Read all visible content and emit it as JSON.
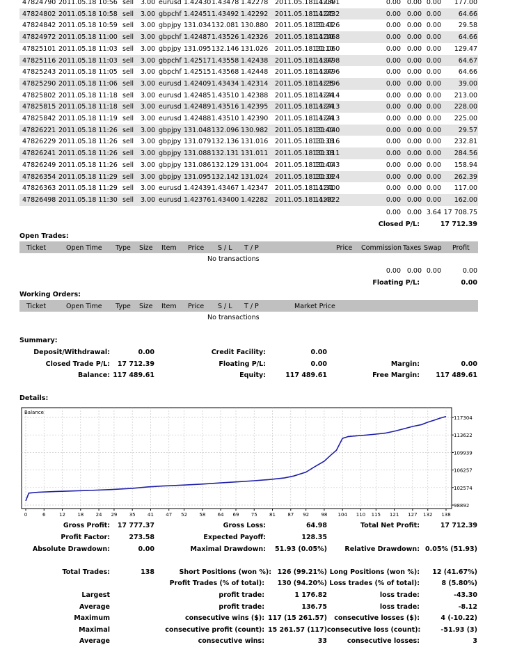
{
  "closed_trades": [
    {
      "ticket": "47824790",
      "open_time": "2011.05.18 10:56",
      "type": "sell",
      "size": "3.00",
      "item": "eurusd",
      "price": "1.42430",
      "sl": "1.43478",
      "tp": "1.42278",
      "close_time": "2011.05.18 11:04",
      "close_price": "1.42391",
      "commission": "0.00",
      "taxes": "0.00",
      "swap": "0.00",
      "profit": "177.00"
    },
    {
      "ticket": "47824802",
      "open_time": "2011.05.18 10:58",
      "type": "sell",
      "size": "3.00",
      "item": "gbpchf",
      "price": "1.42451",
      "sl": "1.43492",
      "tp": "1.42292",
      "close_time": "2011.05.18 11:25",
      "close_price": "1.42432",
      "commission": "0.00",
      "taxes": "0.00",
      "swap": "0.00",
      "profit": "64.66"
    },
    {
      "ticket": "47824842",
      "open_time": "2011.05.18 10:59",
      "type": "sell",
      "size": "3.00",
      "item": "gbpjpy",
      "price": "131.034",
      "sl": "132.081",
      "tp": "130.880",
      "close_time": "2011.05.18 11:41",
      "close_price": "131.026",
      "commission": "0.00",
      "taxes": "0.00",
      "swap": "0.00",
      "profit": "29.58"
    },
    {
      "ticket": "47824972",
      "open_time": "2011.05.18 11:00",
      "type": "sell",
      "size": "3.00",
      "item": "gbpchf",
      "price": "1.42487",
      "sl": "1.43526",
      "tp": "1.42326",
      "close_time": "2011.05.18 11:10",
      "close_price": "1.42468",
      "commission": "0.00",
      "taxes": "0.00",
      "swap": "0.00",
      "profit": "64.66"
    },
    {
      "ticket": "47825101",
      "open_time": "2011.05.18 11:03",
      "type": "sell",
      "size": "3.00",
      "item": "gbpjpy",
      "price": "131.095",
      "sl": "132.146",
      "tp": "131.026",
      "close_time": "2011.05.18 11:10",
      "close_price": "131.060",
      "commission": "0.00",
      "taxes": "0.00",
      "swap": "0.00",
      "profit": "129.47"
    },
    {
      "ticket": "47825116",
      "open_time": "2011.05.18 11:03",
      "type": "sell",
      "size": "3.00",
      "item": "gbpchf",
      "price": "1.42517",
      "sl": "1.43558",
      "tp": "1.42438",
      "close_time": "2011.05.18 11:07",
      "close_price": "1.42498",
      "commission": "0.00",
      "taxes": "0.00",
      "swap": "0.00",
      "profit": "64.67"
    },
    {
      "ticket": "47825243",
      "open_time": "2011.05.18 11:05",
      "type": "sell",
      "size": "3.00",
      "item": "gbpchf",
      "price": "1.42515",
      "sl": "1.43568",
      "tp": "1.42448",
      "close_time": "2011.05.18 11:07",
      "close_price": "1.42496",
      "commission": "0.00",
      "taxes": "0.00",
      "swap": "0.00",
      "profit": "64.66"
    },
    {
      "ticket": "47825290",
      "open_time": "2011.05.18 11:06",
      "type": "sell",
      "size": "3.00",
      "item": "eurusd",
      "price": "1.42409",
      "sl": "1.43434",
      "tp": "1.42314",
      "close_time": "2011.05.18 11:25",
      "close_price": "1.42396",
      "commission": "0.00",
      "taxes": "0.00",
      "swap": "0.00",
      "profit": "39.00"
    },
    {
      "ticket": "47825802",
      "open_time": "2011.05.18 11:18",
      "type": "sell",
      "size": "3.00",
      "item": "eurusd",
      "price": "1.42485",
      "sl": "1.43510",
      "tp": "1.42388",
      "close_time": "2011.05.18 11:24",
      "close_price": "1.42414",
      "commission": "0.00",
      "taxes": "0.00",
      "swap": "0.00",
      "profit": "213.00"
    },
    {
      "ticket": "47825815",
      "open_time": "2011.05.18 11:18",
      "type": "sell",
      "size": "3.00",
      "item": "eurusd",
      "price": "1.42489",
      "sl": "1.43516",
      "tp": "1.42395",
      "close_time": "2011.05.18 11:24",
      "close_price": "1.42413",
      "commission": "0.00",
      "taxes": "0.00",
      "swap": "0.00",
      "profit": "228.00"
    },
    {
      "ticket": "47825842",
      "open_time": "2011.05.18 11:19",
      "type": "sell",
      "size": "3.00",
      "item": "eurusd",
      "price": "1.42488",
      "sl": "1.43510",
      "tp": "1.42390",
      "close_time": "2011.05.18 11:24",
      "close_price": "1.42413",
      "commission": "0.00",
      "taxes": "0.00",
      "swap": "0.00",
      "profit": "225.00"
    },
    {
      "ticket": "47826221",
      "open_time": "2011.05.18 11:26",
      "type": "sell",
      "size": "3.00",
      "item": "gbpjpy",
      "price": "131.048",
      "sl": "132.096",
      "tp": "130.982",
      "close_time": "2011.05.18 11:40",
      "close_price": "131.040",
      "commission": "0.00",
      "taxes": "0.00",
      "swap": "0.00",
      "profit": "29.57"
    },
    {
      "ticket": "47826229",
      "open_time": "2011.05.18 11:26",
      "type": "sell",
      "size": "3.00",
      "item": "gbpjpy",
      "price": "131.079",
      "sl": "132.136",
      "tp": "131.016",
      "close_time": "2011.05.18 11:38",
      "close_price": "131.016",
      "commission": "0.00",
      "taxes": "0.00",
      "swap": "0.00",
      "profit": "232.81"
    },
    {
      "ticket": "47826241",
      "open_time": "2011.05.18 11:26",
      "type": "sell",
      "size": "3.00",
      "item": "gbpjpy",
      "price": "131.088",
      "sl": "132.131",
      "tp": "131.011",
      "close_time": "2011.05.18 11:38",
      "close_price": "131.011",
      "commission": "0.00",
      "taxes": "0.00",
      "swap": "0.00",
      "profit": "284.56"
    },
    {
      "ticket": "47826249",
      "open_time": "2011.05.18 11:26",
      "type": "sell",
      "size": "3.00",
      "item": "gbpjpy",
      "price": "131.086",
      "sl": "132.129",
      "tp": "131.004",
      "close_time": "2011.05.18 11:40",
      "close_price": "131.043",
      "commission": "0.00",
      "taxes": "0.00",
      "swap": "0.00",
      "profit": "158.94"
    },
    {
      "ticket": "47826354",
      "open_time": "2011.05.18 11:29",
      "type": "sell",
      "size": "3.00",
      "item": "gbpjpy",
      "price": "131.095",
      "sl": "132.142",
      "tp": "131.024",
      "close_time": "2011.05.18 11:38",
      "close_price": "131.024",
      "commission": "0.00",
      "taxes": "0.00",
      "swap": "0.00",
      "profit": "262.39"
    },
    {
      "ticket": "47826363",
      "open_time": "2011.05.18 11:29",
      "type": "sell",
      "size": "3.00",
      "item": "eurusd",
      "price": "1.42439",
      "sl": "1.43467",
      "tp": "1.42347",
      "close_time": "2011.05.18 11:31",
      "close_price": "1.42400",
      "commission": "0.00",
      "taxes": "0.00",
      "swap": "0.00",
      "profit": "117.00"
    },
    {
      "ticket": "47826498",
      "open_time": "2011.05.18 11:30",
      "type": "sell",
      "size": "3.00",
      "item": "eurusd",
      "price": "1.42376",
      "sl": "1.43400",
      "tp": "1.42282",
      "close_time": "2011.05.18 11:40",
      "close_price": "1.42322",
      "commission": "0.00",
      "taxes": "0.00",
      "swap": "0.00",
      "profit": "162.00"
    }
  ],
  "closed_totals": {
    "commission": "0.00",
    "taxes": "0.00",
    "swap": "3.64",
    "profit": "17 708.75",
    "label": "Closed P/L:",
    "closed_pl": "17 712.39"
  },
  "open_trades": {
    "title": "Open Trades:",
    "headers": {
      "ticket": "Ticket",
      "open_time": "Open Time",
      "type": "Type",
      "size": "Size",
      "item": "Item",
      "price": "Price",
      "sl": "S / L",
      "tp": "T / P",
      "price2": "Price",
      "commission": "Commission",
      "taxes": "Taxes",
      "swap": "Swap",
      "profit": "Profit"
    },
    "empty": "No transactions",
    "totals": {
      "commission": "0.00",
      "taxes": "0.00",
      "swap": "0.00",
      "profit": "0.00"
    },
    "floating_label": "Floating P/L:",
    "floating_value": "0.00"
  },
  "working_orders": {
    "title": "Working Orders:",
    "headers": {
      "ticket": "Ticket",
      "open_time": "Open Time",
      "type": "Type",
      "size": "Size",
      "item": "Item",
      "price": "Price",
      "sl": "S / L",
      "tp": "T / P",
      "market_price": "Market Price"
    },
    "empty": "No transactions"
  },
  "summary": {
    "title": "Summary:",
    "deposit_label": "Deposit/Withdrawal:",
    "deposit": "0.00",
    "credit_label": "Credit Facility:",
    "credit": "0.00",
    "closed_pl_label": "Closed Trade P/L:",
    "closed_pl": "17 712.39",
    "floating_label": "Floating P/L:",
    "floating": "0.00",
    "margin_label": "Margin:",
    "margin": "0.00",
    "balance_label": "Balance:",
    "balance": "117 489.61",
    "equity_label": "Equity:",
    "equity": "117 489.61",
    "free_margin_label": "Free Margin:",
    "free_margin": "117 489.61"
  },
  "details_title": "Details:",
  "chart_data": {
    "type": "line",
    "legend": "Balance",
    "x_ticks": [
      "0",
      "6",
      "12",
      "18",
      "24",
      "29",
      "35",
      "41",
      "47",
      "52",
      "58",
      "64",
      "69",
      "75",
      "81",
      "87",
      "92",
      "98",
      "104",
      "110",
      "115",
      "121",
      "127",
      "132",
      "138"
    ],
    "y_ticks": [
      "117304",
      "113622",
      "109939",
      "106257",
      "102574",
      "98892"
    ],
    "ylim": [
      98892,
      117304
    ],
    "xlim": [
      0,
      138
    ],
    "x": [
      0,
      1,
      4,
      10,
      20,
      28,
      35,
      40,
      45,
      52,
      58,
      64,
      70,
      75,
      80,
      85,
      88,
      92,
      95,
      98,
      100,
      102,
      104,
      106,
      108,
      110,
      112,
      115,
      118,
      121,
      124,
      127,
      130,
      132,
      134,
      136,
      138
    ],
    "y": [
      99780,
      101400,
      101580,
      101760,
      101950,
      102150,
      102420,
      102700,
      102900,
      103100,
      103300,
      103550,
      103800,
      104000,
      104250,
      104600,
      105000,
      105800,
      107000,
      108100,
      109300,
      110400,
      112900,
      113300,
      113400,
      113500,
      113600,
      113800,
      114000,
      114400,
      114900,
      115400,
      115800,
      116300,
      116700,
      117150,
      117490
    ],
    "grid": true
  },
  "stats": {
    "gross_profit_label": "Gross Profit:",
    "gross_profit": "17 777.37",
    "gross_loss_label": "Gross Loss:",
    "gross_loss": "64.98",
    "total_net_profit_label": "Total Net Profit:",
    "total_net_profit": "17 712.39",
    "profit_factor_label": "Profit Factor:",
    "profit_factor": "273.58",
    "expected_payoff_label": "Expected Payoff:",
    "expected_payoff": "128.35",
    "abs_drawdown_label": "Absolute Drawdown:",
    "abs_drawdown": "0.00",
    "max_drawdown_label": "Maximal Drawdown:",
    "max_drawdown": "51.93 (0.05%)",
    "rel_drawdown_label": "Relative Drawdown:",
    "rel_drawdown": "0.05% (51.93)",
    "total_trades_label": "Total Trades:",
    "total_trades": "138",
    "short_label": "Short Positions (won %):",
    "short": "126 (99.21%)",
    "long_label": "Long Positions (won %):",
    "long": "12 (41.67%)",
    "profit_trades_label": "Profit Trades (% of total):",
    "profit_trades": "130 (94.20%)",
    "loss_trades_label": "Loss trades (% of total):",
    "loss_trades": "8 (5.80%)",
    "largest_label": "Largest",
    "largest_profit_label": "profit trade:",
    "largest_profit": "1 176.82",
    "largest_loss_label": "loss trade:",
    "largest_loss": "-43.30",
    "average_label": "Average",
    "average_profit_label": "profit trade:",
    "average_profit": "136.75",
    "average_loss_label": "loss trade:",
    "average_loss": "-8.12",
    "maximum_label": "Maximum",
    "max_cons_wins_label": "consecutive wins ($):",
    "max_cons_wins": "117 (15 261.57)",
    "max_cons_losses_label": "consecutive losses ($):",
    "max_cons_losses": "4 (-10.22)",
    "maximal_label": "Maximal",
    "maximal_cons_profit_label": "consecutive profit (count):",
    "maximal_cons_profit": "15 261.57 (117)",
    "maximal_cons_loss_label": "consecutive loss (count):",
    "maximal_cons_loss": "-51.93 (3)",
    "avg2_label": "Average",
    "avg_cons_wins_label": "consecutive wins:",
    "avg_cons_wins": "33",
    "avg_cons_losses_label": "consecutive losses:",
    "avg_cons_losses": "3"
  }
}
